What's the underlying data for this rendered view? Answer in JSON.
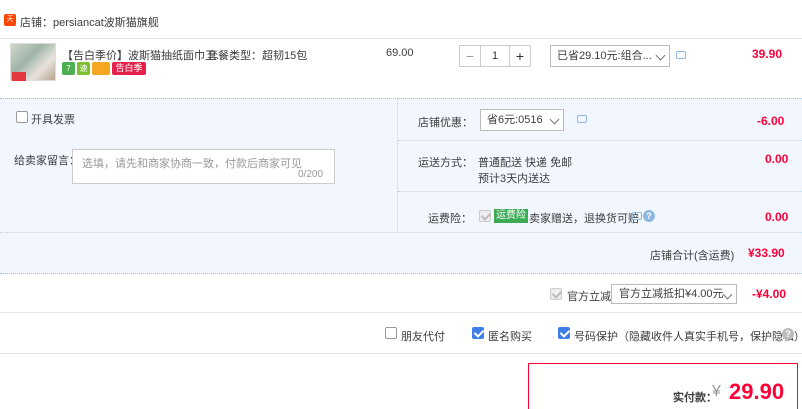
{
  "shop": {
    "icon_text": "天猫",
    "label": "店铺：persiancat波斯猫旗舰"
  },
  "item": {
    "title": "【告白季价】波斯猫抽纸面巾卫...",
    "spec": "套餐类型：超韧15包",
    "unit_price": "69.00",
    "quantity": "1",
    "qty_minus": "−",
    "qty_plus": "+",
    "promo_selected": "已省29.10元:组合...",
    "row_total": "39.90",
    "badges": [
      "7",
      "速",
      "",
      "告白季"
    ]
  },
  "options": {
    "invoice_label": "开具发票",
    "message_label": "给卖家留言：",
    "message_placeholder": "选填，请先和商家协商一致，付款后商家可见",
    "message_count": "0/200",
    "shop_discount_label": "店铺优惠：",
    "shop_discount_selected": "省6元:0516",
    "shop_discount_amount": "-6.00",
    "shipping_label": "运送方式：",
    "shipping_method": "普通配送 快递 免邮",
    "shipping_eta": "预计3天内送达",
    "shipping_amount": "0.00",
    "insurance_label": "运费险：",
    "insurance_tag": "运费险",
    "insurance_text": "卖家赠送，退换货可赔",
    "insurance_amount": "0.00",
    "shop_total_label": "店铺合计(含运费)",
    "shop_total_amount": "¥33.90"
  },
  "official": {
    "label": "官方立减",
    "selected": "官方立减抵扣¥4.00元",
    "amount": "-¥4.00"
  },
  "extras": {
    "friend_pay": "朋友代付",
    "anonymous": "匿名购买",
    "phone_protect": "号码保护（隐藏收件人真实手机号，保护隐私）",
    "help": "?"
  },
  "payment": {
    "label": "实付款：",
    "currency": "¥",
    "amount": "29.90"
  },
  "colors": {
    "accent_red": "#ff0036",
    "panel_bg": "#f2f7ff",
    "check_blue": "#3f7ee8"
  }
}
